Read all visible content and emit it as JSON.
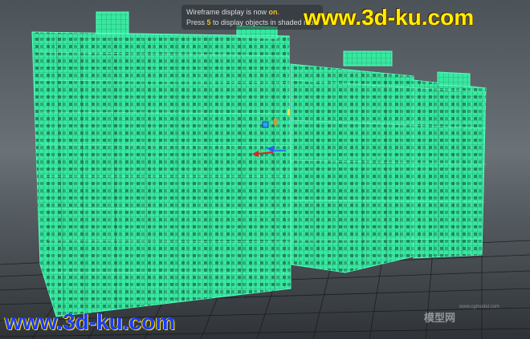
{
  "hud": {
    "line1_prefix": "Wireframe display is now ",
    "line1_state": "on",
    "line1_suffix": ".",
    "line2_prefix": "Press ",
    "line2_key": "5",
    "line2_suffix": " to display objects in shaded mo"
  },
  "watermark": {
    "top": "www.3d-ku.com",
    "bottom": "www.3d-ku.com"
  },
  "logo": {
    "text": "模型网",
    "sub": "www.cgmodel.com"
  },
  "colors": {
    "wireframe": "#3cf5a8",
    "viewport_bg": "#5f676c",
    "grid": "#1a1d20",
    "hud_highlight": "#f0c020"
  },
  "icons": [
    "manipulator-x-arrow-icon",
    "manipulator-y-arrow-icon",
    "manipulator-z-arrow-icon",
    "pivot-icon"
  ]
}
